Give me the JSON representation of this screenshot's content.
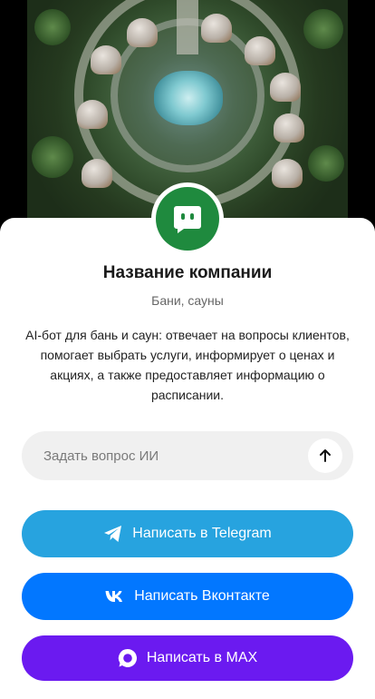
{
  "company": {
    "name": "Название компании",
    "category": "Бани, сауны",
    "description": "AI-бот для бань и саун: отвечает на вопросы клиентов, помогает выбрать услуги, информирует о ценах и акциях, а также предоставляет информацию о расписании."
  },
  "ask": {
    "placeholder": "Задать вопрос ИИ",
    "send_icon": "arrow-up-icon"
  },
  "buttons": {
    "telegram": {
      "label": "Написать в Telegram",
      "icon": "telegram-icon",
      "color": "#27a3df"
    },
    "vk": {
      "label": "Написать Вконтакте",
      "icon": "vk-icon",
      "color": "#0277ff"
    },
    "max": {
      "label": "Написать в MAX",
      "icon": "max-icon",
      "color": "#6b1af0"
    }
  },
  "colors": {
    "avatar_bg": "#1f8a3e"
  }
}
